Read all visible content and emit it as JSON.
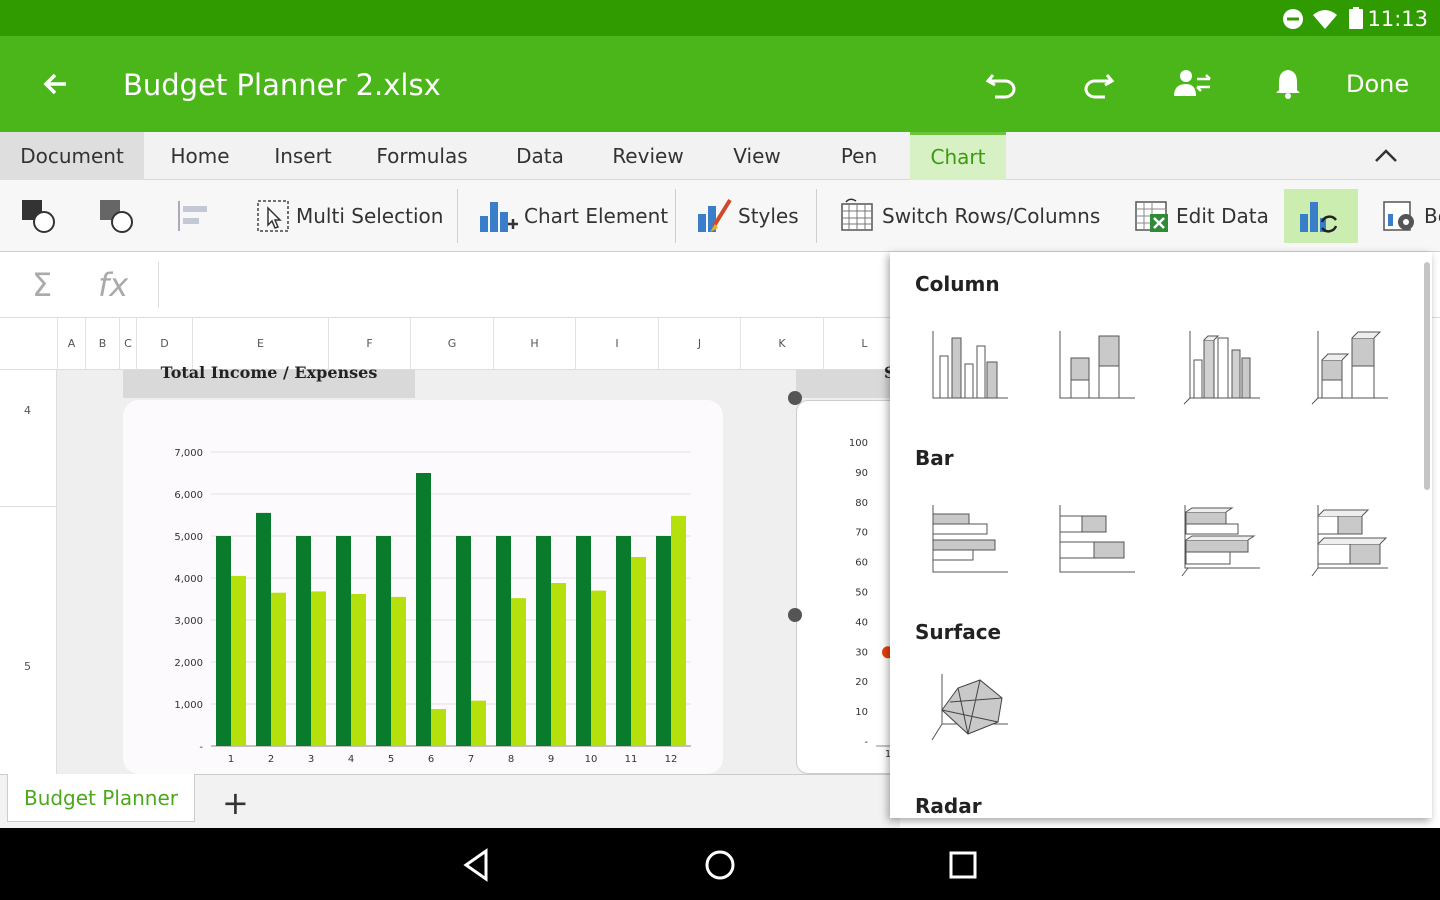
{
  "status": {
    "time": "11:13"
  },
  "app": {
    "title": "Budget Planner 2.xlsx",
    "done_label": "Done"
  },
  "tabs": [
    "Document",
    "Home",
    "Insert",
    "Formulas",
    "Data",
    "Review",
    "View",
    "Pen",
    "Chart"
  ],
  "active_tab": "Chart",
  "toolbar": {
    "multi_selection": "Multi Selection",
    "chart_element": "Chart Element",
    "styles": "Styles",
    "switch_rows_columns": "Switch Rows/Columns",
    "edit_data": "Edit Data",
    "partial_label": "Be"
  },
  "formula": {
    "sigma": "Σ",
    "fx": "fx"
  },
  "columns": [
    "A",
    "B",
    "C",
    "D",
    "E",
    "F",
    "G",
    "H",
    "I",
    "J",
    "K",
    "L"
  ],
  "rows": [
    "4",
    "5"
  ],
  "chart": {
    "title": "Total Income / Expenses",
    "chart_data": {
      "type": "bar",
      "categories": [
        "1",
        "2",
        "3",
        "4",
        "5",
        "6",
        "7",
        "8",
        "9",
        "10",
        "11",
        "12"
      ],
      "series": [
        {
          "color": "#0a7a2c",
          "values": [
            5000,
            5550,
            5000,
            5000,
            5000,
            6500,
            5000,
            5000,
            5000,
            5000,
            5000,
            5000
          ]
        },
        {
          "color": "#b5e00c",
          "values": [
            4050,
            3650,
            3680,
            3620,
            3550,
            880,
            1080,
            3520,
            3880,
            3700,
            4500,
            5480
          ]
        }
      ],
      "ylim": [
        0,
        7000
      ],
      "yticks": [
        "-",
        "1,000",
        "2,000",
        "3,000",
        "4,000",
        "5,000",
        "6,000",
        "7,000"
      ]
    }
  },
  "chart2": {
    "title_fragment": "S",
    "yticks": [
      "-",
      "10",
      "20",
      "30",
      "40",
      "50",
      "60",
      "70",
      "80",
      "90",
      "100"
    ],
    "x_fragment": "1",
    "point_color": "#e8400c"
  },
  "sheets": {
    "active": "Budget Planner",
    "add_label": "+"
  },
  "dropdown": {
    "sections": [
      "Column",
      "Bar",
      "Surface",
      "Radar"
    ]
  }
}
